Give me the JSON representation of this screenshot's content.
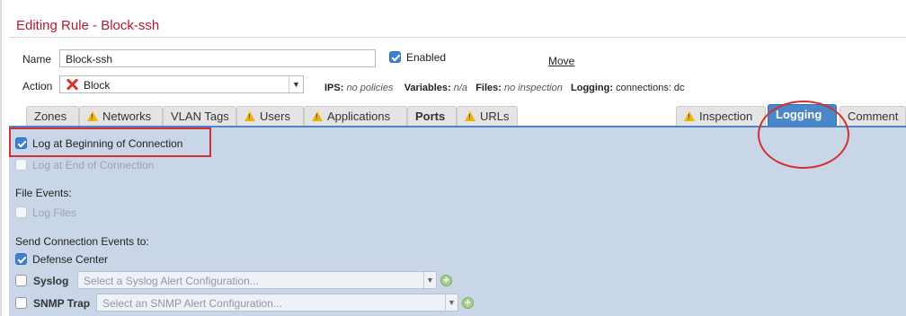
{
  "header": {
    "title": "Editing Rule - Block-ssh"
  },
  "form": {
    "name_label": "Name",
    "name_value": "Block-ssh",
    "enabled_label": "Enabled",
    "move_label": "Move",
    "action_label": "Action",
    "action_value": "Block",
    "action_icon": "x-icon"
  },
  "meta": {
    "ips_label": "IPS:",
    "ips_value": "no policies",
    "variables_label": "Variables:",
    "variables_value": "n/a",
    "files_label": "Files:",
    "files_value": "no inspection",
    "logging_label": "Logging:",
    "logging_value": "connections: dc"
  },
  "tabs": [
    {
      "label": "Zones",
      "warning": false
    },
    {
      "label": "Networks",
      "warning": true
    },
    {
      "label": "VLAN Tags",
      "warning": false
    },
    {
      "label": "Users",
      "warning": true
    },
    {
      "label": "Applications",
      "warning": true
    },
    {
      "label": "Ports",
      "warning": false
    },
    {
      "label": "URLs",
      "warning": true
    },
    {
      "label": "Inspection",
      "warning": true
    },
    {
      "label": "Logging",
      "warning": false,
      "active": true
    },
    {
      "label": "Comment",
      "warning": false
    }
  ],
  "logging": {
    "log_beginning": "Log at Beginning of Connection",
    "log_end": "Log at End of Connection",
    "file_events": "File Events:",
    "log_files": "Log Files",
    "send_events": "Send Connection Events to:",
    "defense_center": "Defense Center",
    "syslog_label": "Syslog",
    "syslog_placeholder": "Select a Syslog Alert Configuration...",
    "snmp_label": "SNMP Trap",
    "snmp_placeholder": "Select an SNMP Alert Configuration..."
  },
  "colors": {
    "title": "#b11a2e",
    "tab_active": "#4a87c8",
    "panel": "#c9d6e7",
    "highlight": "#d32f2f"
  }
}
